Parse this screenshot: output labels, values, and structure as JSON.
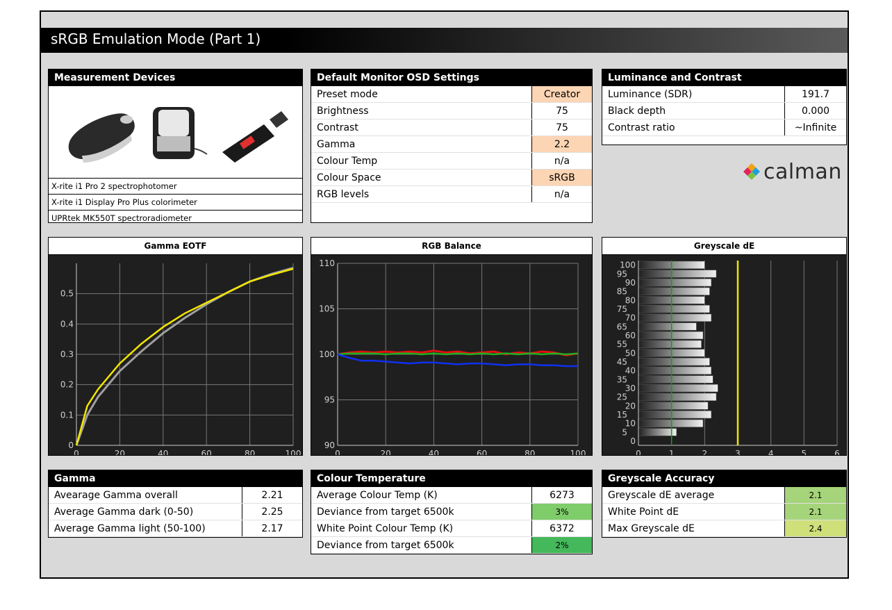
{
  "title": "sRGB Emulation Mode (Part 1)",
  "measurement_devices": {
    "heading": "Measurement Devices",
    "devices": [
      "X-rite i1 Pro 2 spectrophotomer",
      "X-rite i1 Display Pro Plus colorimeter",
      "UPRtek MK550T spectroradiometer"
    ]
  },
  "osd": {
    "heading": "Default Monitor OSD Settings",
    "rows": [
      {
        "label": "Preset mode",
        "value": "Creator",
        "highlight": true
      },
      {
        "label": "Brightness",
        "value": "75",
        "highlight": false
      },
      {
        "label": "Contrast",
        "value": "75",
        "highlight": false
      },
      {
        "label": "Gamma",
        "value": "2.2",
        "highlight": true
      },
      {
        "label": "Colour Temp",
        "value": "n/a",
        "highlight": false
      },
      {
        "label": "Colour Space",
        "value": "sRGB",
        "highlight": true
      },
      {
        "label": "RGB levels",
        "value": "n/a",
        "highlight": false
      }
    ]
  },
  "luminance": {
    "heading": "Luminance and Contrast",
    "rows": [
      {
        "label": "Luminance (SDR)",
        "value": "191.7"
      },
      {
        "label": "Black depth",
        "value": "0.000"
      },
      {
        "label": "Contrast ratio",
        "value": "~Infinite"
      }
    ]
  },
  "logo": {
    "text": "calman",
    "icon": "calman-diamond-icon"
  },
  "gamma": {
    "heading": "Gamma",
    "rows": [
      {
        "label": "Avearage Gamma overall",
        "value": "2.21"
      },
      {
        "label": "Average Gamma dark (0-50)",
        "value": "2.25"
      },
      {
        "label": "Average Gamma light (50-100)",
        "value": "2.17"
      }
    ]
  },
  "colour_temp": {
    "heading": "Colour Temperature",
    "rows": [
      {
        "label": "Average Colour Temp (K)",
        "value": "6273",
        "color": ""
      },
      {
        "label": "Deviance from target 6500k",
        "value": "3%",
        "color": "#7fcc6b"
      },
      {
        "label": "White Point Colour Temp (K)",
        "value": "6372",
        "color": ""
      },
      {
        "label": "Deviance from target 6500k",
        "value": "2%",
        "color": "#44b85a"
      }
    ]
  },
  "greyscale_acc": {
    "heading": "Greyscale Accuracy",
    "rows": [
      {
        "label": "Greyscale dE average",
        "value": "2.1",
        "color": "#a6d47a"
      },
      {
        "label": "White Point dE",
        "value": "2.1",
        "color": "#a6d47a"
      },
      {
        "label": "Max Greyscale dE",
        "value": "2.4",
        "color": "#cfe07a"
      }
    ]
  },
  "colors": {
    "highlight": "#fcd5b4",
    "chart_bg": "#1f1f1f"
  },
  "chart_data": [
    {
      "type": "line",
      "title": "Gamma EOTF",
      "xlim": [
        0,
        100
      ],
      "ylim": [
        0,
        0.6
      ],
      "xticks": [
        0,
        20,
        40,
        60,
        80,
        100
      ],
      "yticks": [
        0,
        0.1,
        0.2,
        0.3,
        0.4,
        0.5
      ],
      "ytick_labels": [
        "0",
        "0.1",
        "0.2",
        "0.3",
        "0.4",
        "0.5"
      ],
      "series": [
        {
          "color": "#a0a0a0",
          "x": [
            0,
            5,
            10,
            20,
            30,
            40,
            50,
            60,
            70,
            80,
            90,
            100
          ],
          "y": [
            0,
            0.1,
            0.16,
            0.245,
            0.31,
            0.37,
            0.42,
            0.465,
            0.505,
            0.54,
            0.565,
            0.585
          ]
        },
        {
          "color": "#f2e600",
          "x": [
            0,
            5,
            10,
            20,
            30,
            40,
            50,
            60,
            70,
            80,
            90,
            100
          ],
          "y": [
            0,
            0.13,
            0.185,
            0.27,
            0.335,
            0.39,
            0.435,
            0.47,
            0.505,
            0.54,
            0.562,
            0.582
          ]
        }
      ]
    },
    {
      "type": "line",
      "title": "RGB Balance",
      "xlim": [
        0,
        100
      ],
      "ylim": [
        90,
        110
      ],
      "xticks": [
        0,
        20,
        40,
        60,
        80,
        100
      ],
      "yticks": [
        90,
        95,
        100,
        105,
        110
      ],
      "ytick_labels": [
        "90",
        "95",
        "100",
        "105",
        "110"
      ],
      "series": [
        {
          "color": "#e01010",
          "x": [
            0,
            5,
            10,
            15,
            20,
            25,
            30,
            35,
            40,
            45,
            50,
            55,
            60,
            65,
            70,
            75,
            80,
            85,
            90,
            95,
            100
          ],
          "y": [
            100,
            100.2,
            100.3,
            100.2,
            100.3,
            100.2,
            100.3,
            100.2,
            100.4,
            100.2,
            100.3,
            100.1,
            100.2,
            100.3,
            100.0,
            100.2,
            100.1,
            100.3,
            100.2,
            99.9,
            100.1
          ]
        },
        {
          "color": "#20b020",
          "x": [
            0,
            5,
            10,
            15,
            20,
            25,
            30,
            35,
            40,
            45,
            50,
            55,
            60,
            65,
            70,
            75,
            80,
            85,
            90,
            95,
            100
          ],
          "y": [
            100,
            100.1,
            100.1,
            100.1,
            100.0,
            100.1,
            100.1,
            100.0,
            100.1,
            100.0,
            100.1,
            100.0,
            100.1,
            100.0,
            100.1,
            100.0,
            100.1,
            100.0,
            100.1,
            100.0,
            100.1
          ]
        },
        {
          "color": "#1030f0",
          "x": [
            0,
            5,
            10,
            15,
            20,
            25,
            30,
            35,
            40,
            45,
            50,
            55,
            60,
            65,
            70,
            75,
            80,
            85,
            90,
            95,
            100
          ],
          "y": [
            100,
            99.6,
            99.3,
            99.3,
            99.2,
            99.1,
            99.0,
            99.1,
            99.1,
            99.0,
            98.9,
            99.0,
            99.0,
            98.9,
            98.8,
            98.9,
            98.9,
            98.8,
            98.8,
            98.7,
            98.7
          ]
        }
      ]
    },
    {
      "type": "bar",
      "orientation": "horizontal",
      "title": "Greyscale dE",
      "xlim": [
        0,
        6
      ],
      "xticks": [
        0,
        1,
        2,
        3,
        4,
        5,
        6
      ],
      "categories": [
        100,
        95,
        90,
        85,
        80,
        75,
        70,
        65,
        60,
        55,
        50,
        45,
        40,
        35,
        30,
        25,
        20,
        15,
        10,
        5,
        0
      ],
      "values": [
        2.0,
        2.35,
        2.2,
        2.15,
        2.0,
        2.15,
        2.2,
        1.75,
        1.95,
        1.9,
        2.0,
        2.15,
        2.2,
        2.25,
        2.4,
        2.35,
        2.1,
        2.2,
        1.95,
        1.15,
        0.0
      ],
      "reference_lines": [
        {
          "x": 1,
          "color": "#10a010"
        },
        {
          "x": 3,
          "color": "#f2e600"
        }
      ]
    }
  ]
}
